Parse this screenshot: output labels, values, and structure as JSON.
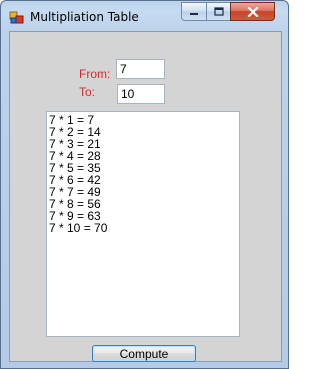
{
  "window": {
    "title": "Multipliation Table",
    "icons": {
      "app": "app-icon",
      "minimize": "minimize-icon",
      "maximize": "maximize-icon",
      "close": "close-icon"
    }
  },
  "form": {
    "from_label": "From:",
    "from_value": "7",
    "to_label": "To:",
    "to_value": "10",
    "label_color": "#d42a2a"
  },
  "results": [
    "7 * 1 = 7",
    "7 * 2 = 14",
    "7 * 3 = 21",
    "7 * 4 = 28",
    "7 * 5 = 35",
    "7 * 6 = 42",
    "7 * 7 = 49",
    "7 * 8 = 56",
    "7 * 9 = 63",
    "7 * 10 = 70"
  ],
  "actions": {
    "compute_label": "Compute"
  }
}
